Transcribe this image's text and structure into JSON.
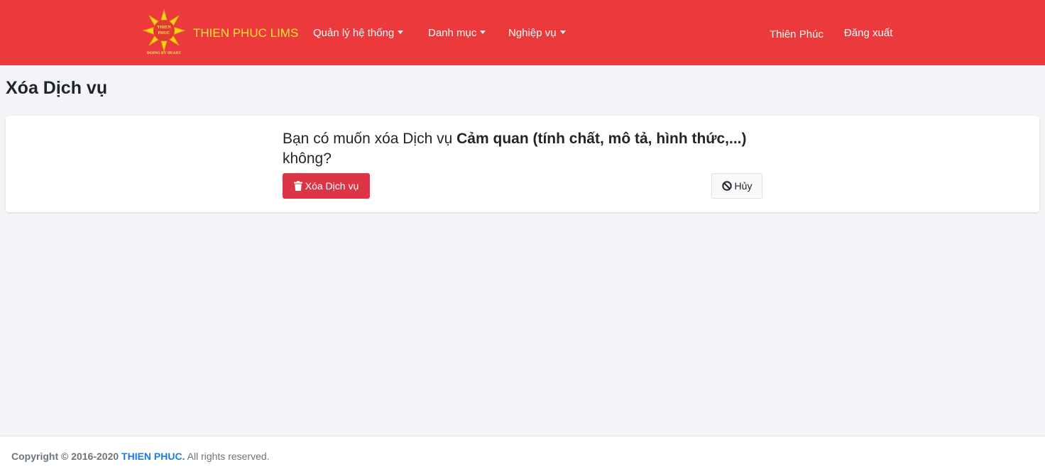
{
  "navbar": {
    "brand": "THIEN PHUC LIMS",
    "logo": {
      "line1": "THIEN",
      "line2": "PHUC",
      "tagline": "DOING BY HEART"
    },
    "menu": [
      {
        "label": "Quản lý hệ thống"
      },
      {
        "label": "Danh mục"
      },
      {
        "label": "Nghiệp vụ"
      }
    ],
    "user": "Thiên Phúc",
    "logout": "Đăng xuất",
    "colors": {
      "background": "#ec3a3c",
      "brand": "#ffe13a"
    }
  },
  "page": {
    "title": "Xóa Dịch vụ"
  },
  "confirm": {
    "prefix": "Bạn có muốn xóa Dịch vụ",
    "item_name": "Cảm quan (tính chất, mô tả, hình thức,...)",
    "suffix": "không?",
    "delete_label": "Xóa Dịch vụ",
    "delete_icon": "trash-icon",
    "cancel_label": "Hủy",
    "cancel_icon": "ban-icon",
    "colors": {
      "delete": "#dc3545"
    }
  },
  "footer": {
    "copyright": "Copyright © 2016-2020",
    "company": "THIEN PHUC.",
    "rights": "All rights reserved."
  }
}
